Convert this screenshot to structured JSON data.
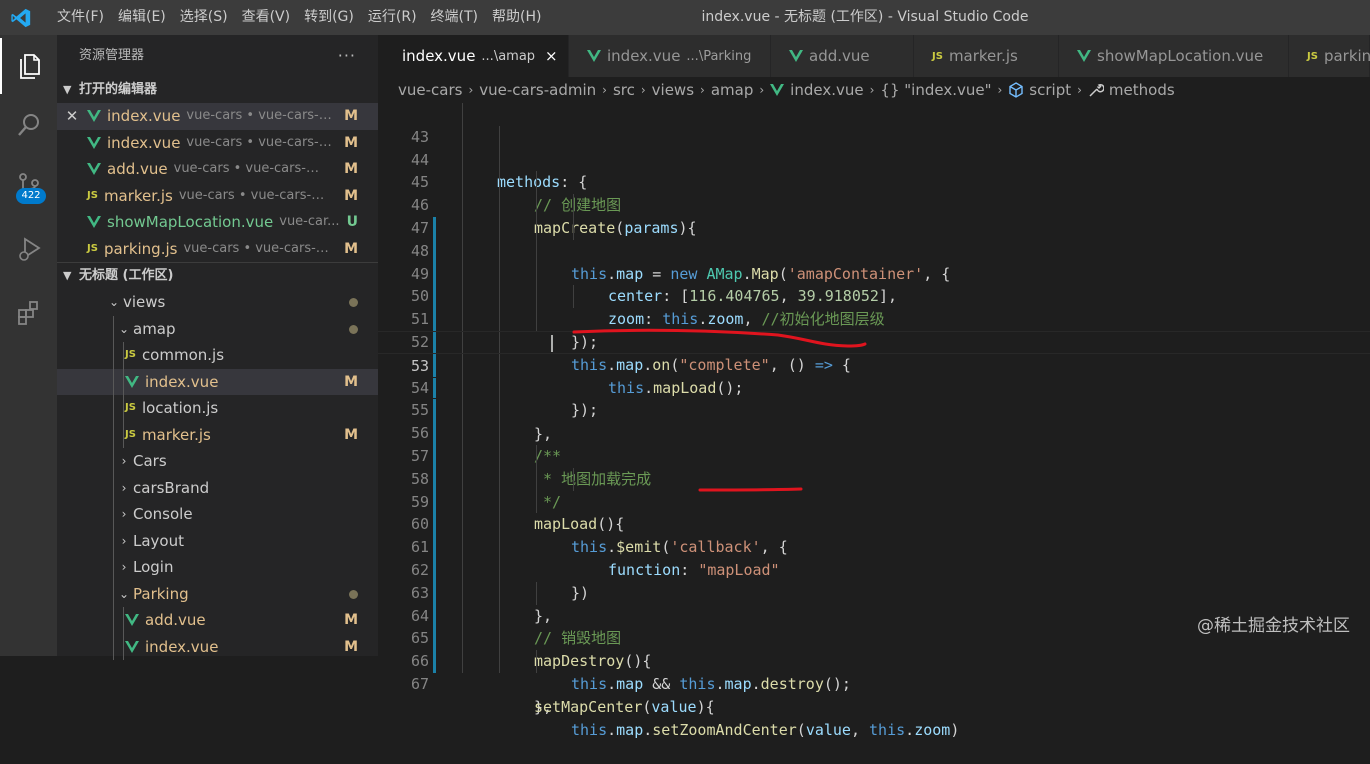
{
  "titlebar": {
    "menu": [
      "文件(F)",
      "编辑(E)",
      "选择(S)",
      "查看(V)",
      "转到(G)",
      "运行(R)",
      "终端(T)",
      "帮助(H)"
    ],
    "window_title": "index.vue - 无标题 (工作区) - Visual Studio Code"
  },
  "activitybar": {
    "scm_badge": "422"
  },
  "sidebar": {
    "title": "资源管理器",
    "more": "···",
    "open_editors_header": "打开的编辑器",
    "open_editors": [
      {
        "name": "index.vue",
        "desc": "vue-cars • vue-cars-a...",
        "status": "M",
        "icon": "vue-icon"
      },
      {
        "name": "index.vue",
        "desc": "vue-cars • vue-cars-a...",
        "status": "M",
        "icon": "vue-icon"
      },
      {
        "name": "add.vue",
        "desc": "vue-cars • vue-cars-ad...",
        "status": "M",
        "icon": "vue-icon"
      },
      {
        "name": "marker.js",
        "desc": "vue-cars • vue-cars-a...",
        "status": "M",
        "icon": "js-icon"
      },
      {
        "name": "showMapLocation.vue",
        "desc": "vue-car...",
        "status": "U",
        "icon": "vue-icon"
      },
      {
        "name": "parking.js",
        "desc": "vue-cars • vue-cars-a...",
        "status": "M",
        "icon": "js-icon"
      }
    ],
    "workspace_header": "无标题 (工作区)",
    "tree": [
      {
        "label": "views",
        "status": ""
      },
      {
        "label": "amap",
        "status": ""
      },
      {
        "label": "common.js",
        "status": ""
      },
      {
        "label": "index.vue",
        "status": "M"
      },
      {
        "label": "location.js",
        "status": ""
      },
      {
        "label": "marker.js",
        "status": "M"
      },
      {
        "label": "Cars",
        "status": ""
      },
      {
        "label": "carsBrand",
        "status": ""
      },
      {
        "label": "Console",
        "status": ""
      },
      {
        "label": "Layout",
        "status": ""
      },
      {
        "label": "Login",
        "status": ""
      },
      {
        "label": "Parking",
        "status": ""
      },
      {
        "label": "add.vue",
        "status": "M"
      },
      {
        "label": "index.vue",
        "status": "M"
      }
    ]
  },
  "tabs": [
    {
      "name": "index.vue",
      "desc": "...\\amap",
      "close": "×"
    },
    {
      "name": "index.vue",
      "desc": "...\\Parking"
    },
    {
      "name": "add.vue",
      "desc": ""
    },
    {
      "name": "marker.js",
      "desc": ""
    },
    {
      "name": "showMapLocation.vue",
      "desc": ""
    },
    {
      "name": "parkin",
      "desc": ""
    }
  ],
  "breadcrumb": {
    "parts": [
      "vue-cars",
      "vue-cars-admin",
      "src",
      "views",
      "amap",
      "index.vue",
      "{} \"index.vue\"",
      "script",
      "methods"
    ]
  },
  "code": {
    "line_numbers": [
      "43",
      "44",
      "45",
      "46",
      "47",
      "48",
      "49",
      "50",
      "51",
      "52",
      "53",
      "54",
      "55",
      "56",
      "57",
      "58",
      "59",
      "60",
      "61",
      "62",
      "63",
      "64",
      "65",
      "66",
      "67"
    ],
    "lines": [
      "methods: {",
      "// 创建地图",
      "mapCreate(params){",
      "this.map = new AMap.Map('amapContainer', {",
      "center: [116.404765, 39.918052],",
      "zoom: this.zoom, //初始化地图层级",
      "});",
      "this.map.on(\"complete\", () => {",
      "this.mapLoad();",
      "});",
      "},",
      "/**",
      " * 地图加载完成",
      " */",
      "mapLoad(){",
      "this.$emit('callback', {",
      "function: \"mapLoad\"",
      "})",
      "},",
      "// 销毁地图",
      "mapDestroy(){",
      "this.map && this.map.destroy();",
      "},",
      "setMapCenter(value){",
      "this.map.setZoomAndCenter(value, this.zoom)"
    ]
  },
  "watermark": "@稀土掘金技术社区",
  "colors": {
    "accent": "#007acc",
    "annotation": "#e0141e"
  }
}
